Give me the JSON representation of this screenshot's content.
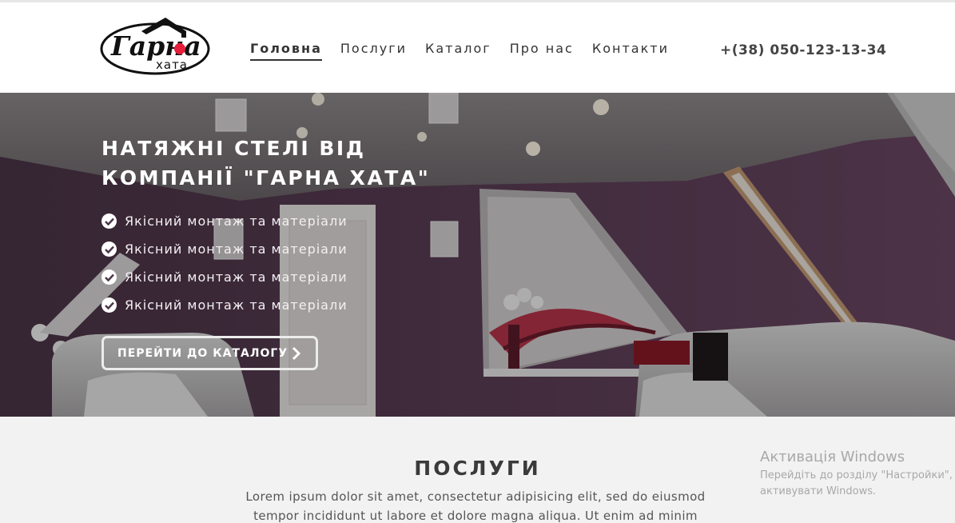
{
  "header": {
    "logo": {
      "line1": "Гарна",
      "line2": "хата"
    },
    "nav": [
      {
        "label": "Головна",
        "active": true
      },
      {
        "label": "Послуги",
        "active": false
      },
      {
        "label": "Каталог",
        "active": false
      },
      {
        "label": "Про нас",
        "active": false
      },
      {
        "label": "Контакти",
        "active": false
      }
    ],
    "phone": "+(38) 050-123-13-34"
  },
  "hero": {
    "title": "Натяжні стелі від компанії \"Гарна Хата\"",
    "features": [
      "Якісний монтаж та матеріали",
      "Якісний монтаж та матеріали",
      "Якісний монтаж та матеріали",
      "Якісний монтаж та матеріали"
    ],
    "cta_label": "ПЕРЕЙТИ ДО КАТАЛОГУ"
  },
  "services": {
    "title": "ПОСЛУГИ",
    "text": "Lorem ipsum dolor sit amet, consectetur adipisicing elit, sed do eiusmod tempor incididunt ut labore et dolore magna aliqua. Ut enim ad minim veniam, quis no-"
  },
  "windows_activation": {
    "title": "Активація Windows",
    "line1": "Перейдіть до розділу \"Настройки\",",
    "line2": "активувати Windows."
  },
  "colors": {
    "accent": "#e61e3c",
    "wall": "#4a3747",
    "text_dark": "#333333"
  }
}
